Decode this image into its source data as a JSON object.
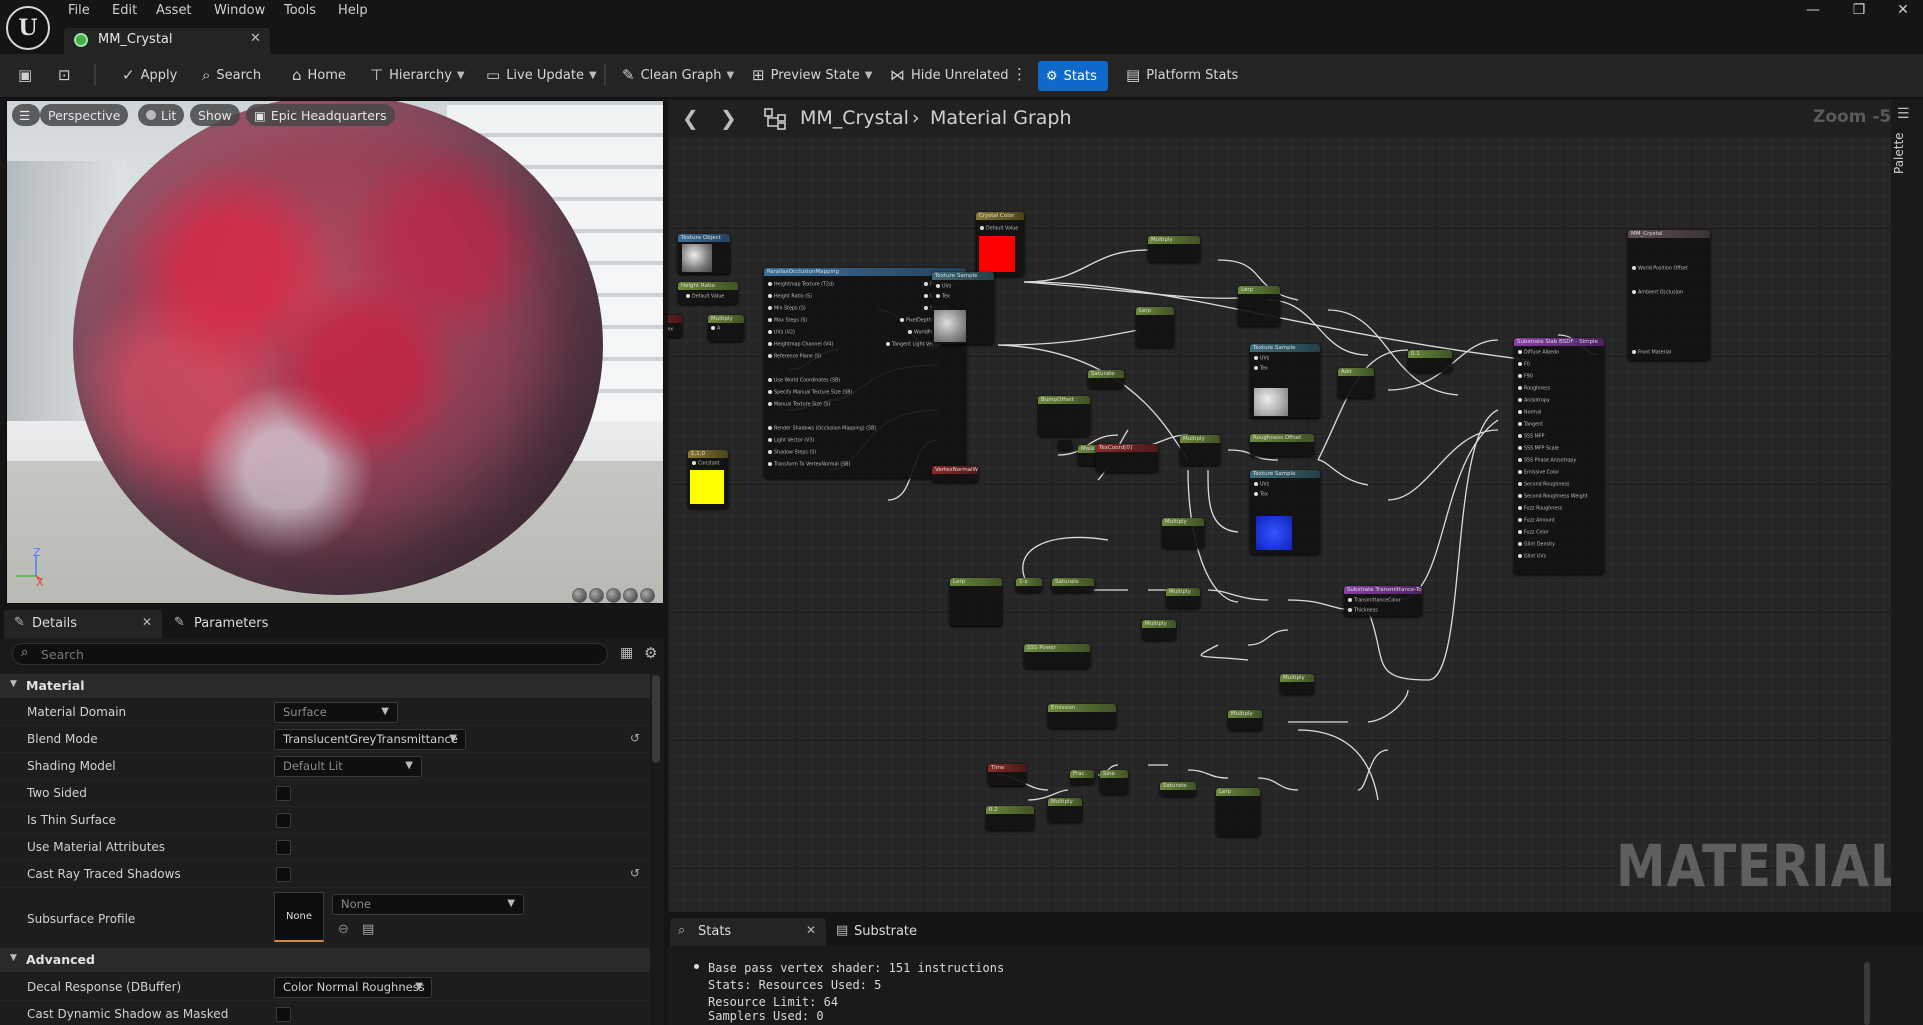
{
  "menu": [
    "File",
    "Edit",
    "Asset",
    "Window",
    "Tools",
    "Help"
  ],
  "document_tab": {
    "title": "MM_Crystal"
  },
  "toolbar": {
    "apply": "Apply",
    "search": "Search",
    "home": "Home",
    "hierarchy": "Hierarchy",
    "live_update": "Live Update",
    "clean_graph": "Clean Graph",
    "preview_state": "Preview State",
    "hide_unrelated": "Hide Unrelated",
    "stats": "Stats",
    "platform_stats": "Platform Stats"
  },
  "viewport": {
    "perspective": "Perspective",
    "lit": "Lit",
    "show": "Show",
    "environment": "Epic Headquarters",
    "axis_z": "Z",
    "axis_x": "X"
  },
  "details": {
    "tab_details": "Details",
    "tab_parameters": "Parameters",
    "search_placeholder": "Search",
    "section_material": "Material",
    "section_advanced": "Advanced",
    "rows": {
      "material_domain": {
        "label": "Material Domain",
        "value": "Surface"
      },
      "blend_mode": {
        "label": "Blend Mode",
        "value": "TranslucentGreyTransmittance"
      },
      "shading_model": {
        "label": "Shading Model",
        "value": "Default Lit"
      },
      "two_sided": {
        "label": "Two Sided"
      },
      "thin_surface": {
        "label": "Is Thin Surface"
      },
      "material_attributes": {
        "label": "Use Material Attributes"
      },
      "ray_traced_shadows": {
        "label": "Cast Ray Traced Shadows"
      },
      "subsurface_profile": {
        "label": "Subsurface Profile",
        "thumb": "None",
        "value": "None"
      },
      "decal_response": {
        "label": "Decal Response (DBuffer)",
        "value": "Color Normal Roughness"
      },
      "dynamic_shadow_masked": {
        "label": "Cast Dynamic Shadow as Masked"
      }
    }
  },
  "graph": {
    "breadcrumb_asset": "MM_Crystal",
    "breadcrumb_graph": "Material Graph",
    "zoom": "Zoom -5",
    "watermark": "MATERIAL",
    "palette": "Palette"
  },
  "stats": {
    "tab_stats": "Stats",
    "tab_substrate": "Substrate",
    "lines": [
      "Base pass vertex shader: 151 instructions",
      "Stats: Resources Used: 5",
      "Resource Limit: 64",
      "Samplers Used: 0"
    ]
  },
  "colors": {
    "accent": "#0e69c8",
    "crystal_color": "#ff0000",
    "constant_color": "#ffff00",
    "normal_color": "#2244ff"
  }
}
